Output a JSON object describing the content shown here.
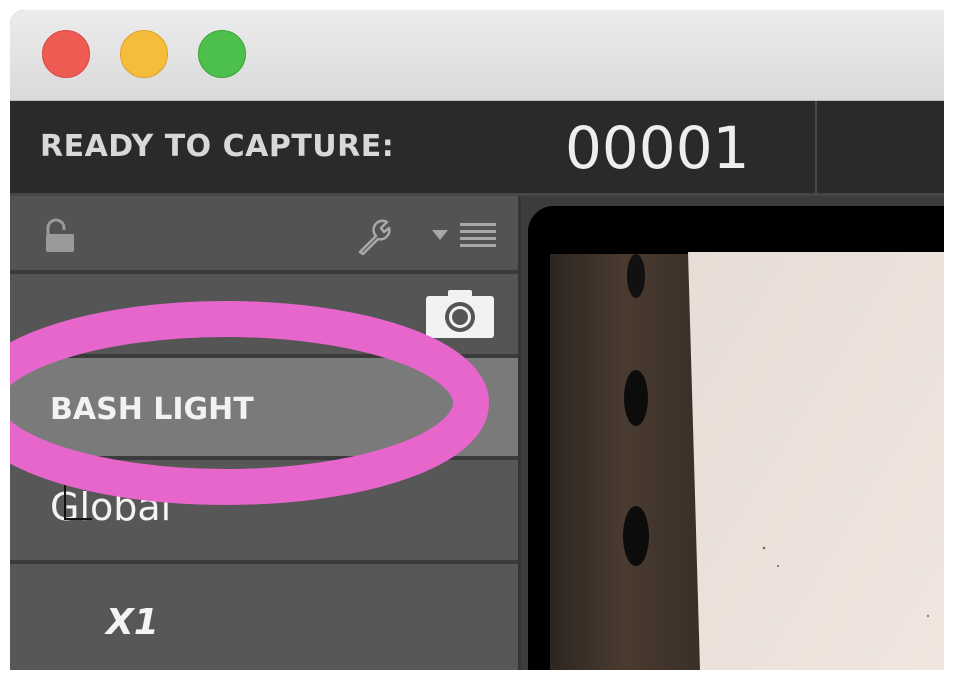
{
  "window": {
    "traffic_lights": [
      "close",
      "minimize",
      "maximize"
    ]
  },
  "capture_bar": {
    "ready_label": "READY TO CAPTURE:",
    "frame_counter": "00001"
  },
  "sidebar": {
    "toolbar_icons": [
      "lock-icon",
      "wrench-icon",
      "list-menu-icon"
    ],
    "camera_icon": "camera-icon",
    "selected_item": "BASH LIGHT",
    "group_label": "Global",
    "child_item": "X1"
  },
  "annotation": {
    "highlight_color": "#e766cc"
  },
  "colors": {
    "titlebar": "#e3e3e3",
    "capture_bar": "#2a2a2a",
    "sidebar": "#575757",
    "selected_row": "#7a7a7a"
  }
}
